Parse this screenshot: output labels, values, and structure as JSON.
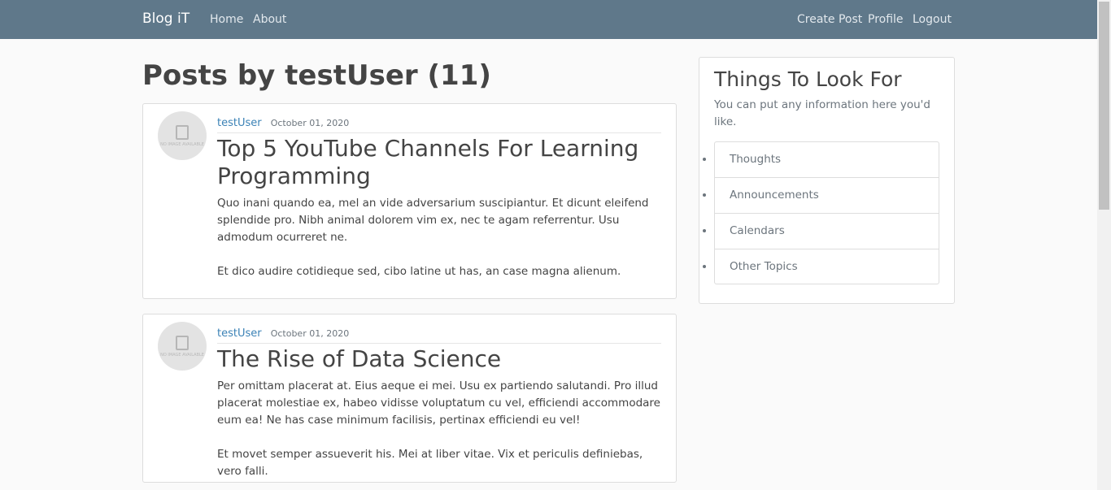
{
  "nav": {
    "brand": "Blog iT",
    "left_links": [
      "Home",
      "About"
    ],
    "right_links": [
      "Create Post",
      "Profile",
      "Logout"
    ]
  },
  "page_title": "Posts by testUser (11)",
  "avatar_placeholder": "NO IMAGE AVAILABLE",
  "posts": [
    {
      "author": "testUser",
      "date": "October 01, 2020",
      "title": "Top 5 YouTube Channels For Learning Programming",
      "paragraphs": [
        "Quo inani quando ea, mel an vide adversarium suscipiantur. Et dicunt eleifend splendide pro. Nibh animal dolorem vim ex, nec te agam referrentur. Usu admodum ocurreret ne.",
        "Et dico audire cotidieque sed, cibo latine ut has, an case magna alienum."
      ]
    },
    {
      "author": "testUser",
      "date": "October 01, 2020",
      "title": "The Rise of Data Science",
      "paragraphs": [
        "Per omittam placerat at. Eius aeque ei mei. Usu ex partiendo salutandi. Pro illud placerat molestiae ex, habeo vidisse voluptatum cu vel, efficiendi accommodare eum ea! Ne has case minimum facilisis, pertinax efficiendi eu vel!",
        "Et movet semper assueverit his. Mei at liber vitae. Vix et periculis definiebas, vero falli."
      ]
    }
  ],
  "sidebar": {
    "title": "Things To Look For",
    "description": "You can put any information here you'd like.",
    "items": [
      "Thoughts",
      "Announcements",
      "Calendars",
      "Other Topics"
    ]
  },
  "colors": {
    "navbar": "#5f788a",
    "link": "#3b82b6",
    "background": "#fafafa"
  }
}
